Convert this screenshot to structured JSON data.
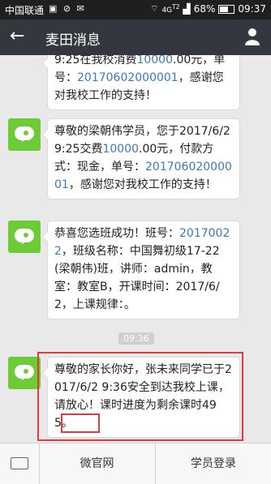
{
  "statusbar": {
    "carrier": "中国联通",
    "icons": "▣ ⊘ ✉",
    "network": "4G",
    "signal_top": "T2",
    "battery": "68%",
    "time": "09:37"
  },
  "header": {
    "back_glyph": "←",
    "title": "麦田消息"
  },
  "messages": [
    {
      "parts": [
        "9:25在我校消费",
        "10000",
        ".00元，单号：",
        "20170602000001",
        "，感谢您对我校工作的支持！"
      ]
    },
    {
      "parts": [
        "尊敬的梁朝伟学员，您于2017/6/2 9:25交费",
        "10000",
        ".00元，付款方式：现金，单号：",
        "20170602000001",
        "，感谢您对我校工作的支持！"
      ]
    },
    {
      "parts": [
        "恭喜您选班成功！班号：",
        "20170022",
        "，班级名称：中国舞初级17-22(梁朝伟)班，讲师：admin，教室：教室B，开课时间：2017/6/2，上课规律：。"
      ]
    },
    {
      "parts": [
        "尊敬的家长你好，张未来同学已于2017/6/2 9:36安全到达我校上课，请放心！课时进度为剩余课时",
        "495",
        "。"
      ]
    }
  ],
  "timestamp": "09:36",
  "bottom_menu": {
    "item1": "微官网",
    "item2": "学员登录"
  },
  "colors": {
    "link_blue": "#3b79b8",
    "avatar_green": "#6ccb37",
    "highlight_red": "#e03a3a"
  }
}
